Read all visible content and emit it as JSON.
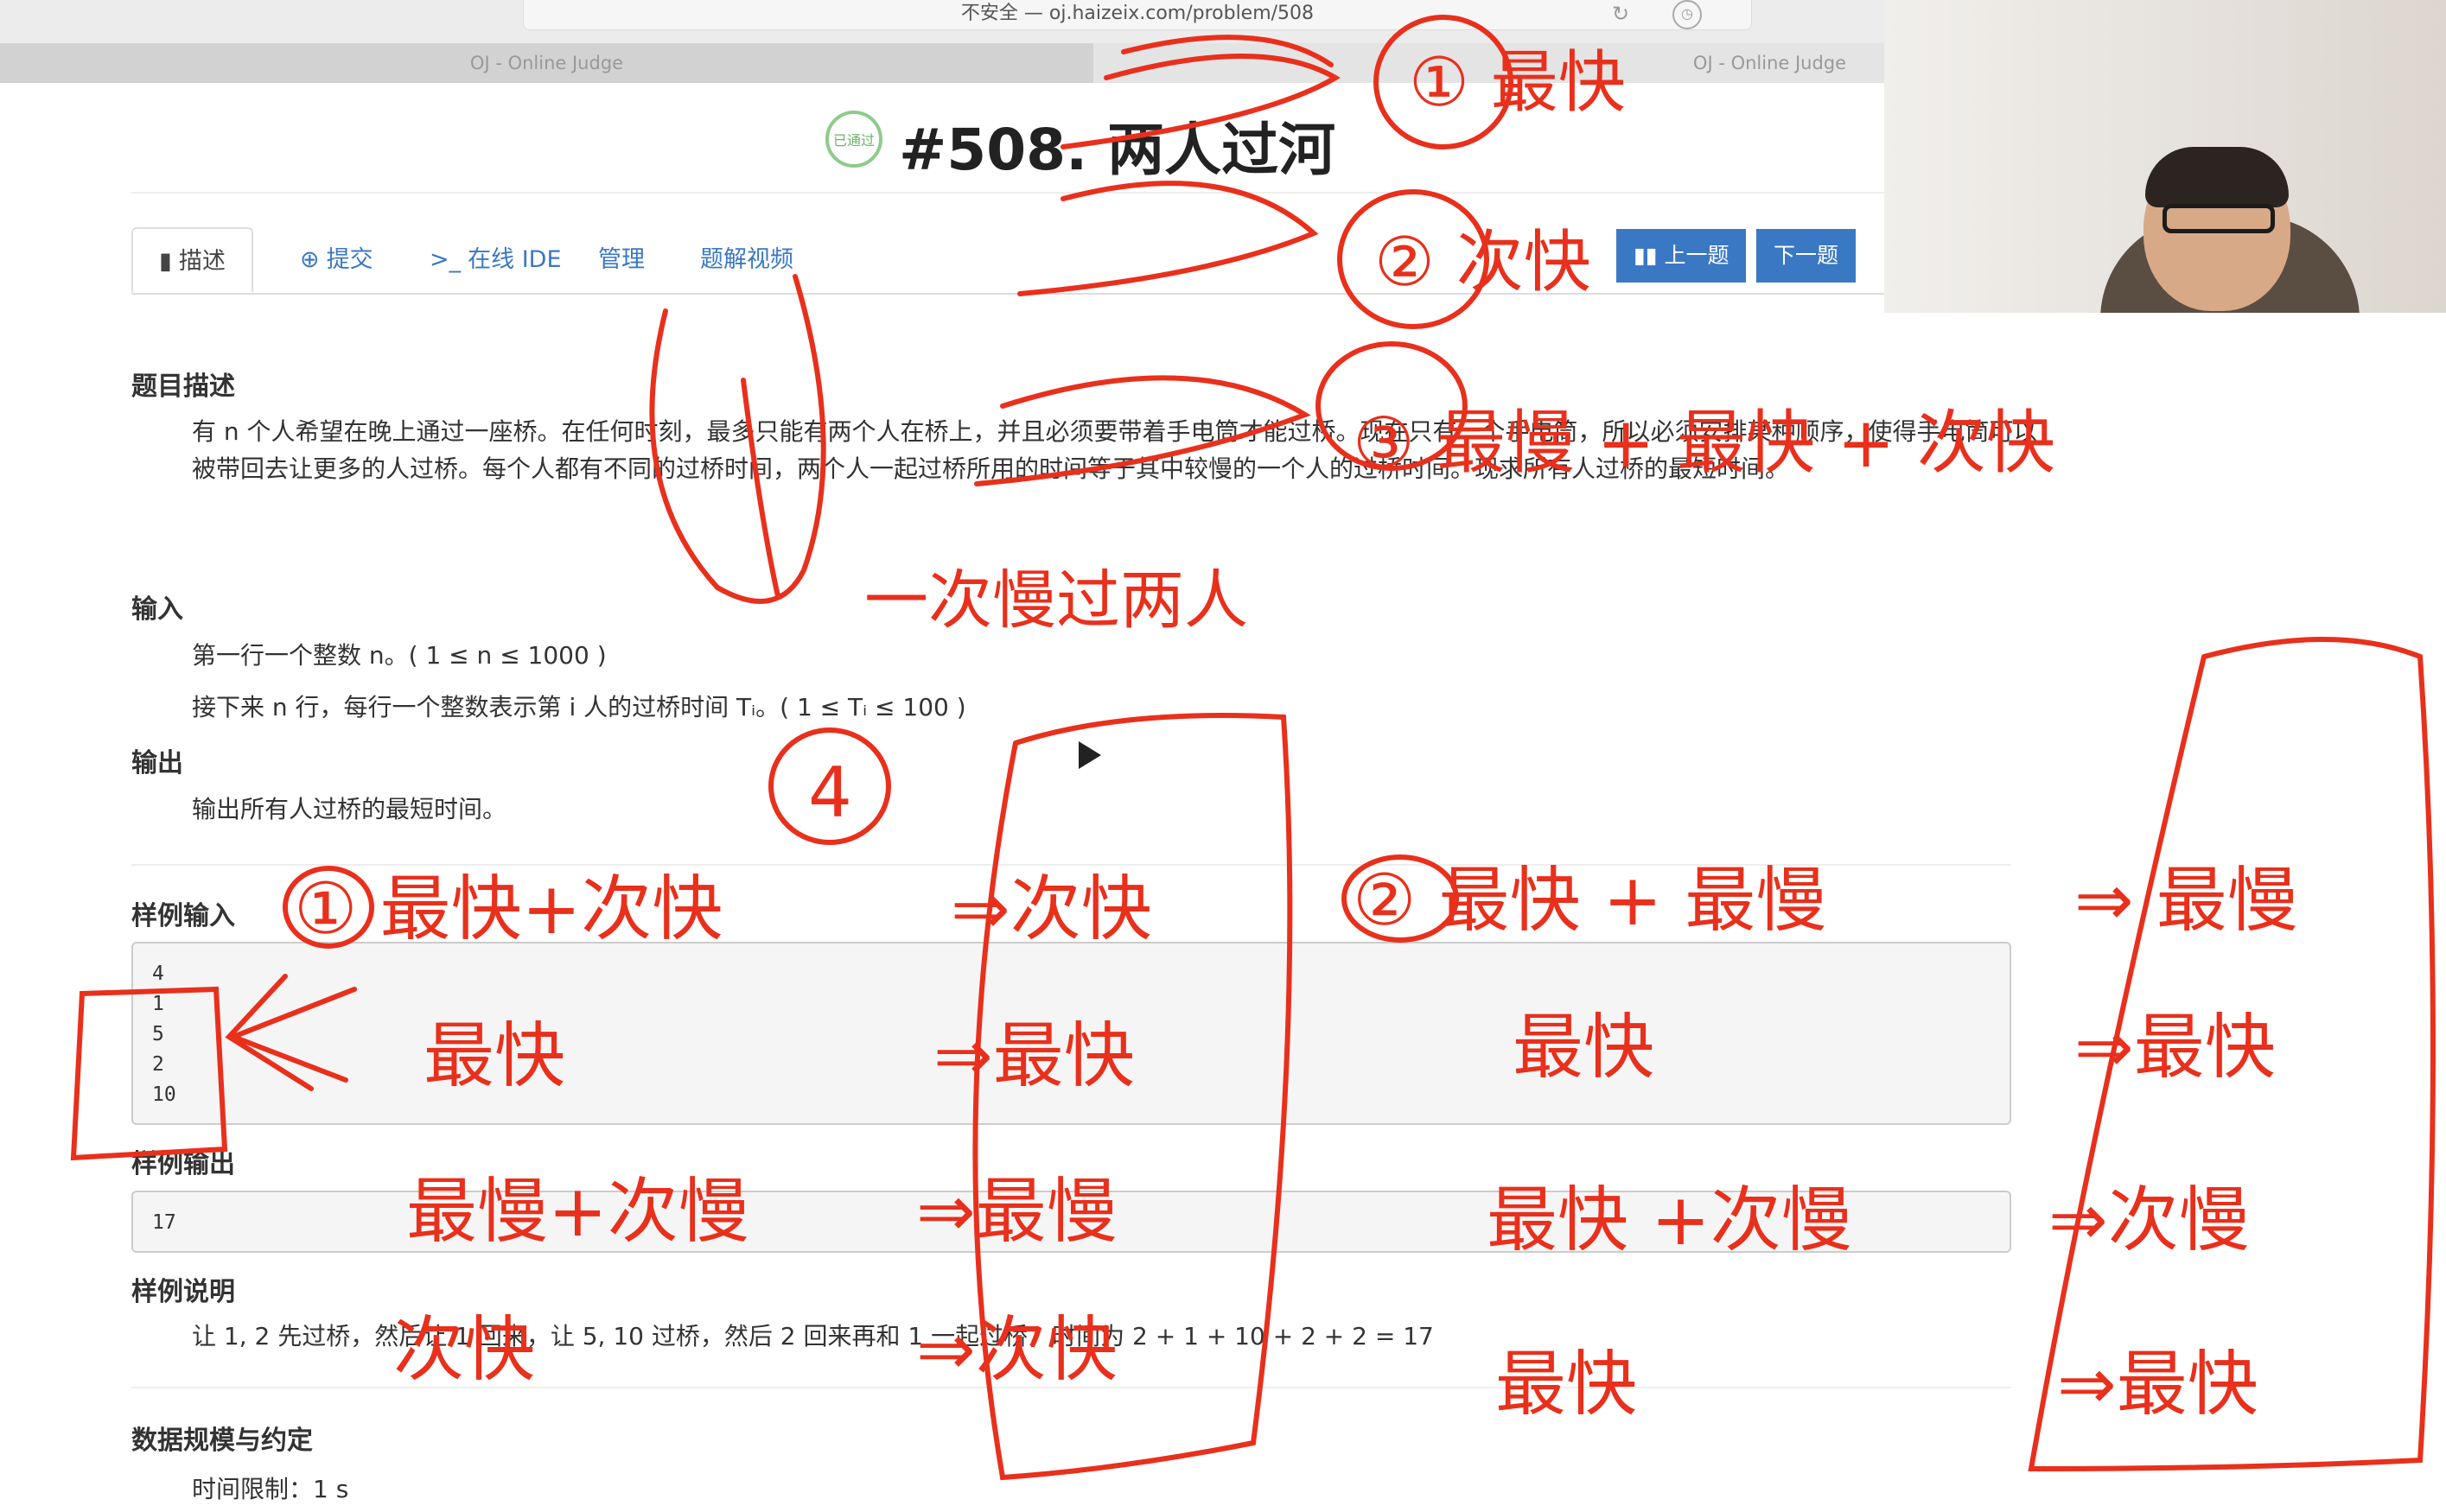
{
  "browser": {
    "url": "不安全 — oj.haizeix.com/problem/508",
    "tabs": [
      "OJ - Online Judge",
      "OJ - Online Judge"
    ]
  },
  "problem": {
    "badge": "已通过",
    "title": "#508. 两人过河",
    "nav_tabs": [
      "描述",
      "提交",
      "在线 IDE",
      "管理",
      "题解视频"
    ],
    "prev_label": "上一题",
    "next_label": "下一题",
    "sections": {
      "desc_title": "题目描述",
      "desc_text": "有 n 个人希望在晚上通过一座桥。在任何时刻，最多只能有两个人在桥上，并且必须要带着手电筒才能过桥。现在只有一个手电筒，所以必须安排某种顺序，使得手电筒可以被带回去让更多的人过桥。每个人都有不同的过桥时间，两个人一起过桥所用的时间等于其中较慢的一个人的过桥时间。现求所有人过桥的最短时间。",
      "input_title": "输入",
      "input_line1": "第一行一个整数 n。( 1 ≤ n ≤ 1000 )",
      "input_line2": "接下来 n 行，每行一个整数表示第 i 人的过桥时间 Tᵢ。( 1 ≤ Tᵢ ≤ 100 )",
      "output_title": "输出",
      "output_line": "输出所有人过桥的最短时间。",
      "sample_in_title": "样例输入",
      "sample_in": [
        "4",
        "1",
        "5",
        "2",
        "10"
      ],
      "sample_out_title": "样例输出",
      "sample_out": "17",
      "explain_title": "样例说明",
      "explain_text": "让 1, 2 先过桥，然后让 1 回来，让 5, 10 过桥，然后 2 回来再和 1 一起过桥，时间为 2 + 1 + 10 + 2 + 2 = 17",
      "limits_title": "数据规模与约定",
      "time_limit": "时间限制：1 s"
    }
  },
  "annotations": {
    "ink_color": "#e8301c",
    "top_list": [
      "① 最快",
      "② 次快",
      "③ 最慢 + 最快 + 次快"
    ],
    "note_one_slow": "一次慢过两人",
    "circle_4": "4",
    "left_plan": [
      "① 最快+次快",
      "⇒次快",
      "最快",
      "⇒最快",
      "最慢+次慢",
      "⇒最慢",
      "次快",
      "⇒次快"
    ],
    "right_plan": [
      "② 最快 + 最慢",
      "⇒ 最慢",
      "最快",
      "⇒最快",
      "最快 +次慢",
      "⇒次慢",
      "最快",
      "⇒最快"
    ]
  }
}
